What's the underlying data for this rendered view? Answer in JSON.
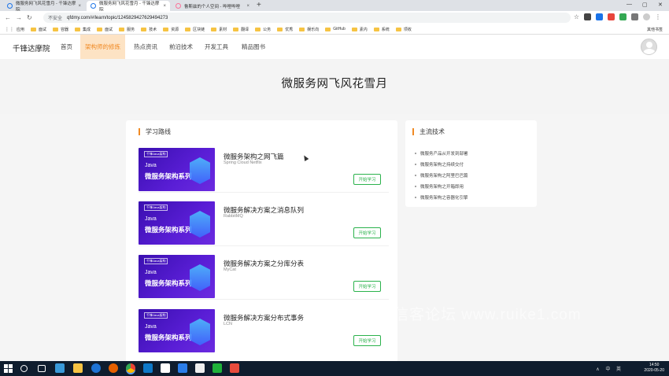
{
  "browser": {
    "tabs": [
      {
        "label": "微服务网飞风花雪月 - 千锋达摩院"
      },
      {
        "label": "微服务网飞风花雪月 - 千锋达摩院"
      },
      {
        "label": "鲁斯兹的个人空间 - 哔哩哔哩"
      }
    ],
    "security": "不安全",
    "url": "qfdmy.com/#/learn/topic/1245829427629494273",
    "bookmarks": [
      "应用",
      "面试",
      "容器",
      "集成",
      "面试",
      "服务",
      "技术",
      "资源",
      "区块链",
      "素材",
      "翻译",
      "公务",
      "优秀",
      "娱乐向",
      "GitHub",
      "素内",
      "系统",
      "项收"
    ],
    "bookmarks_right": "其他书签"
  },
  "site": {
    "logo": "千锋达摩院",
    "nav": [
      "首页",
      "架构师的修炼",
      "热点资讯",
      "前沿技术",
      "开发工具",
      "精品图书"
    ],
    "hero_title": "微服务网飞风花雪月",
    "learning_path_title": "学习路线",
    "mainstream_title": "主流技术",
    "courses": [
      {
        "title": "微服务架构之网飞篇",
        "subtitle": "Spring Cloud Netflix",
        "button": "开始学习",
        "thumb_brand": "千锋Java架构",
        "thumb_java": "Java",
        "thumb_series": "微服务架构系列"
      },
      {
        "title": "微服务解决方案之消息队列",
        "subtitle": "RabbitMQ",
        "button": "开始学习",
        "thumb_brand": "千锋Java架构",
        "thumb_java": "Java",
        "thumb_series": "微服务架构系列"
      },
      {
        "title": "微服务解决方案之分库分表",
        "subtitle": "MyCat",
        "button": "开始学习",
        "thumb_brand": "千锋Java架构",
        "thumb_java": "Java",
        "thumb_series": "微服务架构系列"
      },
      {
        "title": "微服务解决方案分布式事务",
        "subtitle": "LCN",
        "button": "开始学习",
        "thumb_brand": "千锋Java架构",
        "thumb_java": "Java",
        "thumb_series": "微服务架构系列"
      }
    ],
    "mainstream": [
      "微服务产品从开发到部署",
      "微服务架构之持续交付",
      "微服务架构之阿里巴巴篇",
      "微服务架构之开箱即用",
      "微服务架构之容器化引擎"
    ]
  },
  "watermark": "信客论坛 www.ruike1.com",
  "taskbar": {
    "time": "14:50",
    "date": "2020-05-20",
    "tray": "∧ 中 英"
  }
}
